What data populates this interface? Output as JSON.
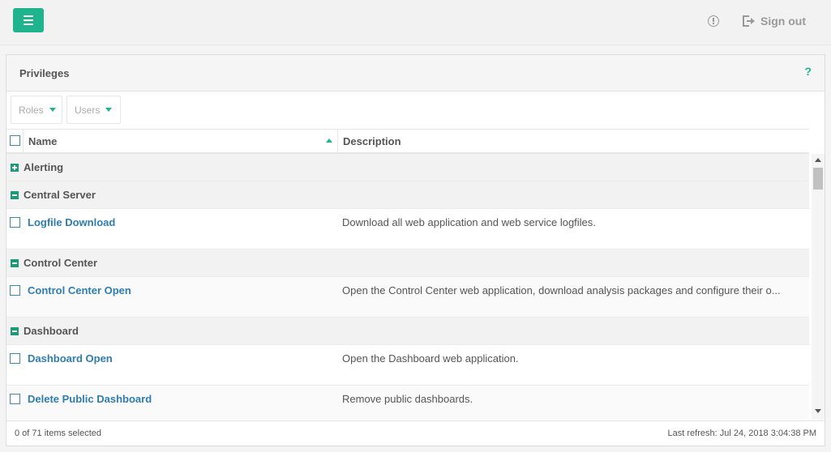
{
  "header": {
    "signout_label": "Sign out"
  },
  "panel": {
    "title": "Privileges",
    "help": "?"
  },
  "filters": {
    "roles": "Roles",
    "users": "Users"
  },
  "columns": {
    "name": "Name",
    "description": "Description"
  },
  "rows": [
    {
      "type": "group",
      "label": "Alerting",
      "expanded": false
    },
    {
      "type": "group",
      "label": "Central Server",
      "expanded": true
    },
    {
      "type": "item",
      "name": "Logfile Download",
      "description": "Download all web application and web service logfiles."
    },
    {
      "type": "group",
      "label": "Control Center",
      "expanded": true
    },
    {
      "type": "item",
      "name": "Control Center Open",
      "description": "Open the Control Center web application, download analysis packages and configure their o..."
    },
    {
      "type": "group",
      "label": "Dashboard",
      "expanded": true
    },
    {
      "type": "item",
      "name": "Dashboard Open",
      "description": "Open the Dashboard web application."
    },
    {
      "type": "item",
      "name": "Delete Public Dashboard",
      "description": "Remove public dashboards."
    }
  ],
  "footer": {
    "selection": "0 of 71 items selected",
    "last_refresh": "Last refresh: Jul 24, 2018 3:04:38 PM"
  },
  "colors": {
    "accent": "#1fb38e",
    "link": "#2f7cae"
  }
}
